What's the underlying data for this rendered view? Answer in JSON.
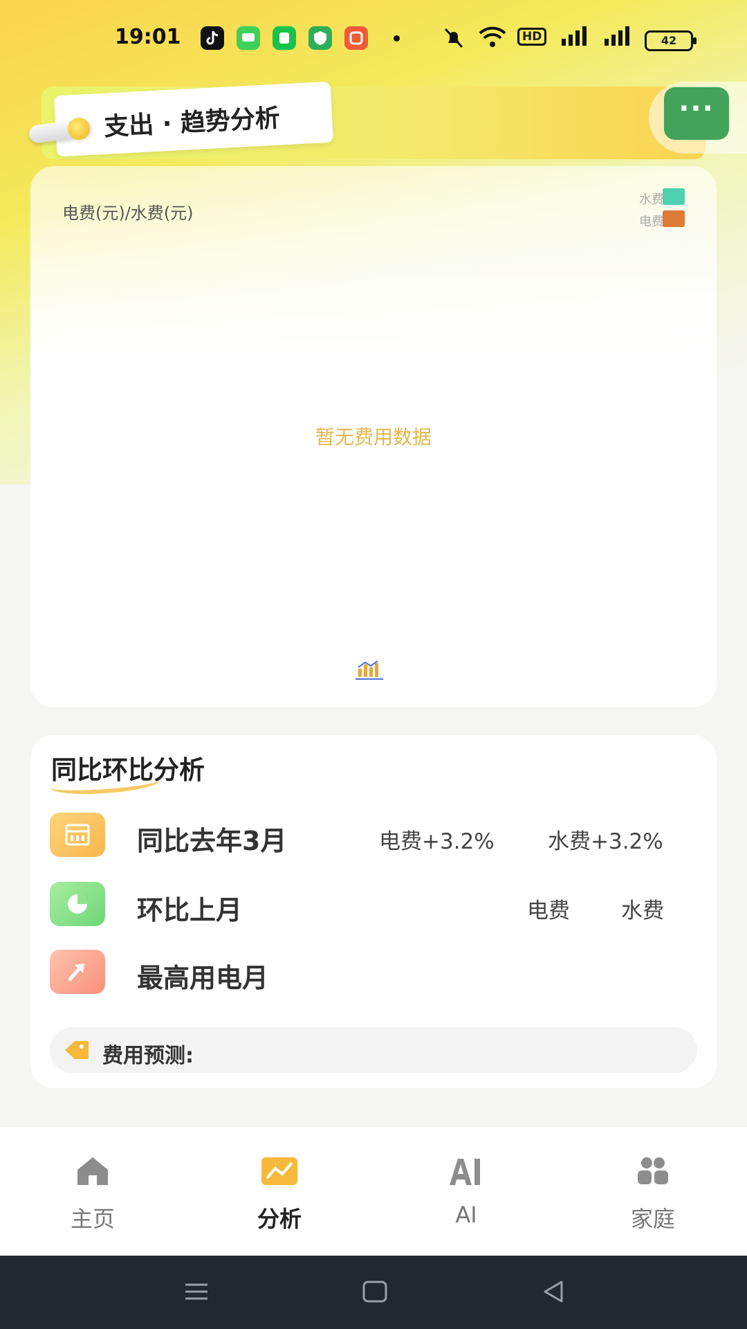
{
  "status_bar": {
    "time": "19:01",
    "battery": "42",
    "network": "HD"
  },
  "header": {
    "title": "支出 · 趋势分析",
    "more_label": "···"
  },
  "chart_data": {
    "type": "bar",
    "ylabel": "电费(元)/水费(元)",
    "series": [
      {
        "name": "水费",
        "color": "#4fd1b0",
        "values": []
      },
      {
        "name": "电费",
        "color": "#dd7a35",
        "values": []
      }
    ],
    "categories": [],
    "empty_text": "暂无费用数据"
  },
  "analysis": {
    "title": "同比环比分析",
    "rows": [
      {
        "label": "同比去年3月",
        "elec": "电费+3.2%",
        "water": "水费+3.2%"
      },
      {
        "label": "环比上月",
        "elec": "电费",
        "water": "水费"
      },
      {
        "label": "最高用电月"
      }
    ],
    "forecast_label": "费用预测:"
  },
  "nav": {
    "items": [
      {
        "label": "主页",
        "icon": "home-icon"
      },
      {
        "label": "分析",
        "icon": "chart-icon"
      },
      {
        "label": "AI",
        "icon": "ai-icon"
      },
      {
        "label": "家庭",
        "icon": "family-icon"
      }
    ],
    "active": "分析"
  },
  "colors": {
    "accent": "#fbd34f",
    "green": "#43a35a",
    "water": "#4fd1b0",
    "electric": "#dd7a35"
  }
}
